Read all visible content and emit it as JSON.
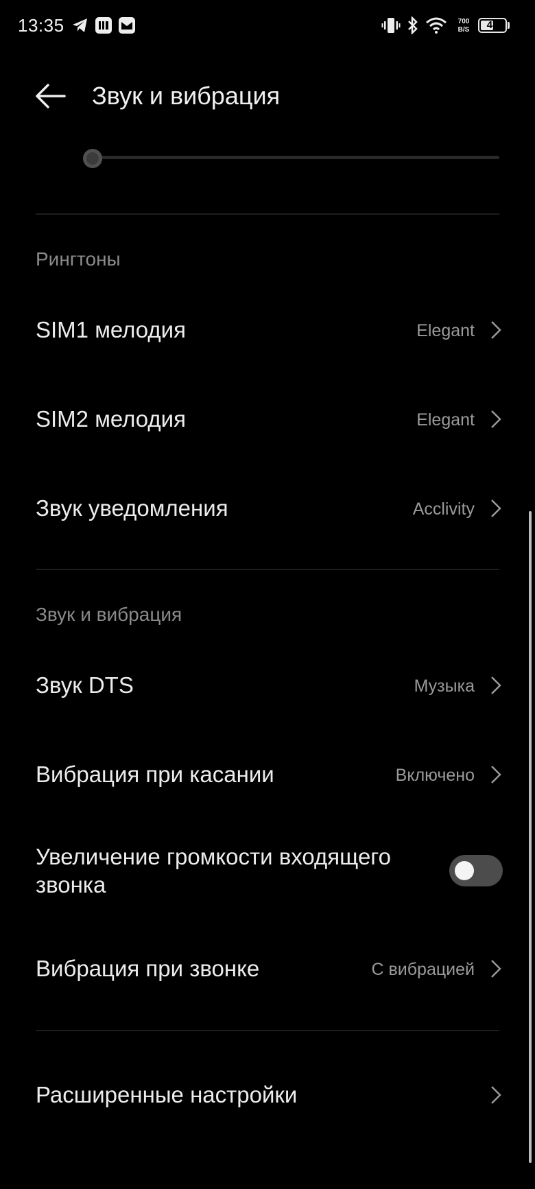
{
  "status_bar": {
    "time": "13:35",
    "speed_value": "700",
    "speed_unit": "B/S",
    "battery": "48",
    "battery_level_percent": 48,
    "icons": [
      "telegram-icon",
      "app-icon",
      "mail-icon",
      "vibrate-icon",
      "bluetooth-icon",
      "wifi-icon"
    ]
  },
  "header": {
    "title": "Звук и вибрация"
  },
  "slider": {
    "level_fraction": 0.0
  },
  "sections": {
    "ringtones": {
      "header": "Рингтоны",
      "rows": [
        {
          "label": "SIM1 мелодия",
          "value": "Elegant"
        },
        {
          "label": "SIM2 мелодия",
          "value": "Elegant"
        },
        {
          "label": "Звук уведомления",
          "value": "Acclivity"
        }
      ]
    },
    "sound": {
      "header": "Звук и вибрация",
      "rows": [
        {
          "label": "Звук DTS",
          "value": "Музыка"
        },
        {
          "label": "Вибрация при касании",
          "value": "Включено"
        },
        {
          "label_line1": "Увеличение громкости входящего",
          "label_line2": "звонка",
          "toggle_on": false
        },
        {
          "label": "Вибрация при звонке",
          "value": "С вибрацией"
        }
      ]
    },
    "advanced": {
      "label": "Расширенные настройки"
    }
  },
  "colors": {
    "background": "#000000",
    "text_primary": "#ececec",
    "text_secondary": "#8a8a8a",
    "toggle_off": "#4c4c4c"
  }
}
